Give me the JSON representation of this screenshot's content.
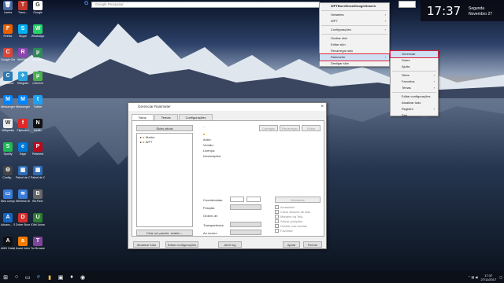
{
  "search": {
    "placeholder": "Google Pesquisar"
  },
  "clock": {
    "time": "17:37",
    "weekday": "Segunda",
    "date": "Novembro 27"
  },
  "desktop_icons": [
    {
      "label": "Lixeira",
      "color": "#4a6aa0",
      "glyph": "🗑"
    },
    {
      "label": "Trans...",
      "color": "#c0392b",
      "glyph": "T"
    },
    {
      "label": "Google",
      "color": "#fff",
      "glyph": "G"
    },
    {
      "label": "Firefox",
      "color": "#e66000",
      "glyph": "F"
    },
    {
      "label": "Skype",
      "color": "#00aff0",
      "glyph": "S"
    },
    {
      "label": "WhatsApp",
      "color": "#25d366",
      "glyph": "W"
    },
    {
      "label": "Google Chrome",
      "color": "#db4437",
      "glyph": "C"
    },
    {
      "label": "WinRAR",
      "color": "#8e44ad",
      "glyph": "R"
    },
    {
      "label": "uTorrent",
      "color": "#2e8b57",
      "glyph": "µ"
    },
    {
      "label": "CCleaner",
      "color": "#2c7bb6",
      "glyph": "C"
    },
    {
      "label": "Telegram",
      "color": "#2aa3df",
      "glyph": "✈"
    },
    {
      "label": "uTorrent",
      "color": "#4caf50",
      "glyph": "µ"
    },
    {
      "label": "Messenger",
      "color": "#0084ff",
      "glyph": "M"
    },
    {
      "label": "Messenger",
      "color": "#0084ff",
      "glyph": "M"
    },
    {
      "label": "Twitter",
      "color": "#1da1f2",
      "glyph": "t"
    },
    {
      "label": "Wikipedia",
      "color": "#eee",
      "glyph": "W"
    },
    {
      "label": "Flipboard",
      "color": "#e12828",
      "glyph": "f"
    },
    {
      "label": "Netflix",
      "color": "#111",
      "glyph": "N"
    },
    {
      "label": "Spotify",
      "color": "#1db954",
      "glyph": "S"
    },
    {
      "label": "Edge",
      "color": "#0078d7",
      "glyph": "e"
    },
    {
      "label": "Pinterest",
      "color": "#bd081c",
      "glyph": "P"
    },
    {
      "label": "Config...",
      "color": "#444",
      "glyph": "⚙"
    },
    {
      "label": "Painel de Controle",
      "color": "#2f6db5",
      "glyph": "▦"
    },
    {
      "label": "Painel de Controle",
      "color": "#2f6db5",
      "glyph": "▦"
    },
    {
      "label": "Meu compu...",
      "color": "#3a7bd5",
      "glyph": "▭"
    },
    {
      "label": "Wireless Netwo...",
      "color": "#3a7bd5",
      "glyph": "≋"
    },
    {
      "label": "Bit-Fixer",
      "color": "#666",
      "glyph": "B"
    },
    {
      "label": "Advanc... System...",
      "color": "#1565c0",
      "glyph": "A"
    },
    {
      "label": "Driver Booster",
      "color": "#d32f2f",
      "glyph": "D"
    },
    {
      "label": "IObit Uninstal...",
      "color": "#2e7d32",
      "glyph": "U"
    },
    {
      "label": "AMD Catalys...",
      "color": "#111",
      "glyph": "A"
    },
    {
      "label": "Avast Intern...",
      "color": "#f57c00",
      "glyph": "a"
    },
    {
      "label": "Tor Browser",
      "color": "#7d4698",
      "glyph": "T"
    }
  ],
  "context_menu": {
    "header": "WPTBoxVilleza/GoogleSearch",
    "items": [
      "Variantes",
      "WP7",
      "Configurações",
      "Ocultar skin",
      "Editar skin",
      "Recarregar skin",
      "Rainmeter",
      "Desligar skin"
    ]
  },
  "submenu": {
    "items": [
      "Gerenciar",
      "Sobre",
      "Ajuda",
      "Skins",
      "Favoritos",
      "Temas",
      "Editar configurações",
      "Atualizar tudo",
      "Registro",
      "Sair"
    ]
  },
  "app_window": {
    "title": "Gerenciar Rainmeter",
    "tabs": [
      "Skins",
      "Temas",
      "Configurações"
    ],
    "active_skins_button": "Skins ativas",
    "tree": [
      "Illustro",
      "WP7"
    ],
    "skin_name": "...",
    "info_labels": [
      "Autor:",
      "Versão:",
      "Licença:",
      "Informações:"
    ],
    "action_buttons": [
      "Carregar",
      "Recarregar",
      "Editar"
    ],
    "create_package": "Criar um pacote .rmskin...",
    "coords_label": "Coordenadas:",
    "position_label": "Posição:",
    "order_label": "Ordem de:",
    "transparency_label": "Transparência:",
    "on_hover_label": "Ao mover:",
    "display_button": "Monitores",
    "checkboxes": [
      "Arrastável",
      "Clicar através de skin",
      "Mantém na Tela",
      "Salvar posições",
      "Ocultar nas bordas",
      "Favoritar"
    ],
    "bottom_buttons": [
      "Atualizar tudo",
      "Editar configurações",
      "Abrir log"
    ],
    "help": "Ajuda",
    "close": "Fechar"
  },
  "taskbar": {
    "time": "17:37",
    "date": "27/11/2017"
  }
}
